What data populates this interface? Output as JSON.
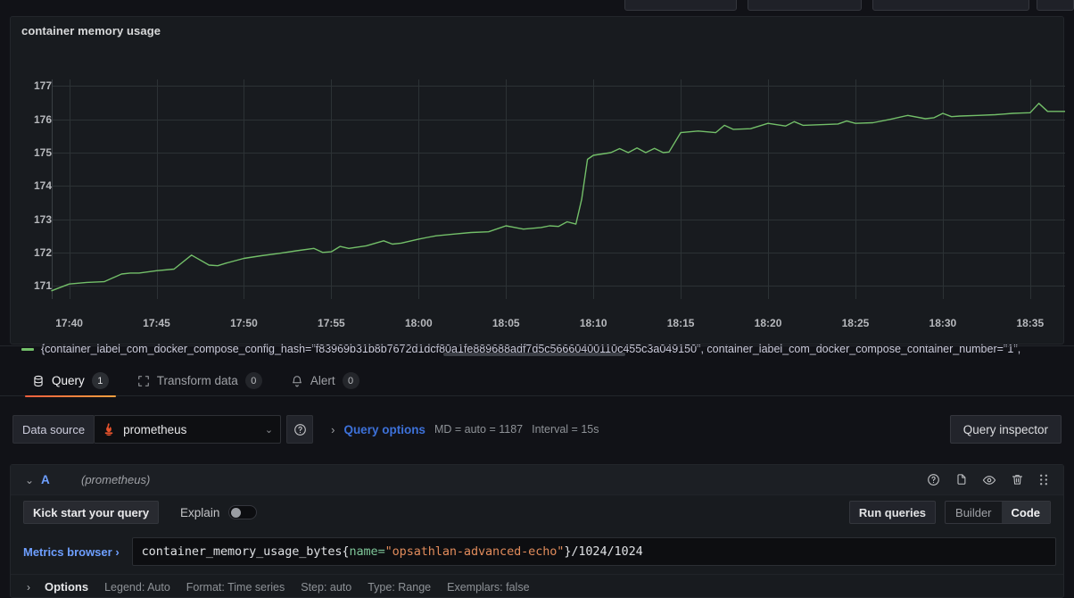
{
  "panel": {
    "title": "container memory usage",
    "legend_label": "{container_label_com_docker_compose_config_hash=\"f83969b31b8b7672d1dcf80a1fe889688adf7d5c56660400110c455c3a049150\", container_label_com_docker_compose_container_number=\"1\","
  },
  "chart_data": {
    "type": "line",
    "title": "container memory usage",
    "xlabel": "",
    "ylabel": "",
    "grid": true,
    "legend_position": "bottom",
    "series_color": "#73bf69",
    "ylim": [
      170.6,
      177.2
    ],
    "yticks": [
      171,
      172,
      173,
      174,
      175,
      176,
      177
    ],
    "xticks": [
      "17:40",
      "17:45",
      "17:50",
      "17:55",
      "18:00",
      "18:05",
      "18:10",
      "18:15",
      "18:20",
      "18:25",
      "18:30",
      "18:35"
    ],
    "xlim": [
      "17:39:00",
      "18:37:00"
    ],
    "series": [
      {
        "name": "{container_label_com_docker_compose_config_hash=\"f83969b31b8b7672d1dcf80a1fe889688adf7d5c56660400110c455c3a049150\", container_label_com_docker_compose_container_number=\"1\",",
        "x": [
          "17:39",
          "17:40",
          "17:41",
          "17:42",
          "17:43",
          "17:43:30",
          "17:44",
          "17:45",
          "17:46",
          "17:47",
          "17:48",
          "17:48:30",
          "17:49",
          "17:50",
          "17:51",
          "17:52",
          "17:53",
          "17:54",
          "17:54:30",
          "17:55",
          "17:55:30",
          "17:56",
          "17:57",
          "17:58",
          "17:58:30",
          "17:59",
          "18:00",
          "18:00:30",
          "18:01",
          "18:02",
          "18:03",
          "18:04",
          "18:05",
          "18:06",
          "18:07",
          "18:07:30",
          "18:08",
          "18:08:30",
          "18:09",
          "18:09:20",
          "18:09:40",
          "18:10",
          "18:11",
          "18:11:30",
          "18:12",
          "18:12:30",
          "18:13",
          "18:13:30",
          "18:14",
          "18:14:20",
          "18:15",
          "18:16",
          "18:17",
          "18:17:30",
          "18:18",
          "18:19",
          "18:20",
          "18:21",
          "18:21:30",
          "18:22",
          "18:23",
          "18:24",
          "18:24:30",
          "18:25",
          "18:26",
          "18:27",
          "18:28",
          "18:29",
          "18:29:30",
          "18:30",
          "18:30:30",
          "18:31",
          "18:32",
          "18:33",
          "18:33:30",
          "18:34",
          "18:35",
          "18:35:30",
          "18:36",
          "18:37"
        ],
        "y": [
          170.85,
          171.05,
          171.1,
          171.12,
          171.35,
          171.38,
          171.38,
          171.45,
          171.5,
          171.92,
          171.62,
          171.6,
          171.68,
          171.82,
          171.9,
          171.97,
          172.05,
          172.12,
          172.0,
          172.02,
          172.18,
          172.12,
          172.2,
          172.35,
          172.25,
          172.28,
          172.4,
          172.45,
          172.5,
          172.55,
          172.6,
          172.62,
          172.8,
          172.7,
          172.75,
          172.8,
          172.78,
          172.92,
          172.85,
          173.6,
          174.8,
          174.92,
          175.0,
          175.12,
          175.0,
          175.14,
          175.0,
          175.13,
          175.0,
          175.02,
          175.6,
          175.65,
          175.6,
          175.82,
          175.7,
          175.72,
          175.88,
          175.8,
          175.93,
          175.82,
          175.84,
          175.86,
          175.95,
          175.88,
          175.9,
          176.0,
          176.12,
          176.02,
          176.05,
          176.18,
          176.08,
          176.1,
          176.12,
          176.14,
          176.16,
          176.18,
          176.2,
          176.48,
          176.24,
          176.24
        ]
      }
    ]
  },
  "tabs": [
    {
      "label": "Query",
      "count": "1",
      "icon": "database-icon",
      "active": true
    },
    {
      "label": "Transform data",
      "count": "0",
      "icon": "transform-icon",
      "active": false
    },
    {
      "label": "Alert",
      "count": "0",
      "icon": "bell-icon",
      "active": false
    }
  ],
  "datasource_row": {
    "label": "Data source",
    "selected": "prometheus",
    "help_icon": "help-circle-icon",
    "query_options_label": "Query options",
    "max_data_points": "MD = auto = 1187",
    "interval": "Interval = 15s",
    "query_inspector_label": "Query inspector"
  },
  "query": {
    "ref_id": "A",
    "datasource_name": "(prometheus)",
    "kick_start_label": "Kick start your query",
    "explain_label": "Explain",
    "explain_on": false,
    "run_queries_label": "Run queries",
    "mode_builder": "Builder",
    "mode_code": "Code",
    "mode_selected": "Code",
    "metrics_browser_label": "Metrics browser ›",
    "expr": {
      "metric": "container_memory_usage_bytes{",
      "label_key": "name=",
      "label_value": "\"opsathlan-advanced-echo\"",
      "close_brace": "}",
      "tail": " /1024/1024",
      "full": "container_memory_usage_bytes{name=\"opsathlan-advanced-echo\"} /1024/1024"
    },
    "header_icons": [
      "help-circle-icon",
      "duplicate-icon",
      "eye-icon",
      "trash-icon",
      "drag-handle-icon"
    ]
  },
  "options": {
    "title": "Options",
    "items": [
      "Legend: Auto",
      "Format: Time series",
      "Step: auto",
      "Type: Range",
      "Exemplars: false"
    ]
  },
  "colors": {
    "accent_blue": "#6e9fff",
    "series_green": "#73bf69",
    "tab_underline": "#f55f3e",
    "panel_bg": "#181b1f",
    "app_bg": "#111217"
  }
}
